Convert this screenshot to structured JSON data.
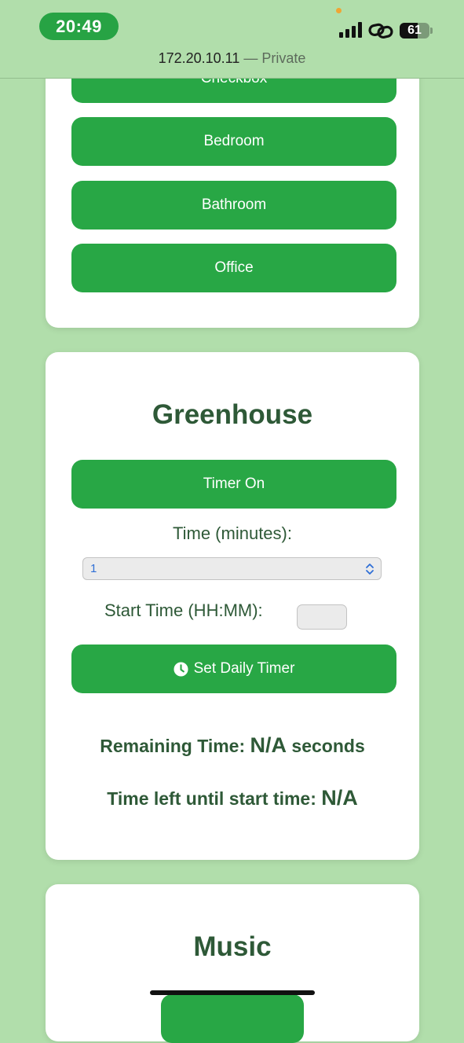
{
  "status_bar": {
    "time": "20:49",
    "battery_level": "61",
    "battery_fraction": 0.61,
    "signal_icon": "cellular-signal-icon",
    "link_icon": "personal-hotspot-link-icon",
    "url": "172.20.10.11",
    "private_label": "— Private"
  },
  "rooms_card": {
    "buttons": [
      {
        "label": "Checkbox"
      },
      {
        "label": "Bedroom"
      },
      {
        "label": "Bathroom"
      },
      {
        "label": "Office"
      }
    ]
  },
  "greenhouse": {
    "title": "Greenhouse",
    "timer_button": "Timer On",
    "time_label": "Time (minutes):",
    "time_select_value": "1",
    "start_time_label": "Start Time (HH:MM):",
    "set_timer_button": "Set Daily Timer",
    "set_timer_icon": "clock-icon",
    "remaining_label": "Remaining Time:",
    "remaining_value": "N/A",
    "remaining_unit": "seconds",
    "start_left_label": "Time left until start time:",
    "start_left_value": "N/A"
  },
  "music": {
    "title": "Music"
  },
  "colors": {
    "page_background": "#b1deab",
    "button_green": "#28a745",
    "heading_text": "#2e5937",
    "clock_pill": "#27a344"
  }
}
